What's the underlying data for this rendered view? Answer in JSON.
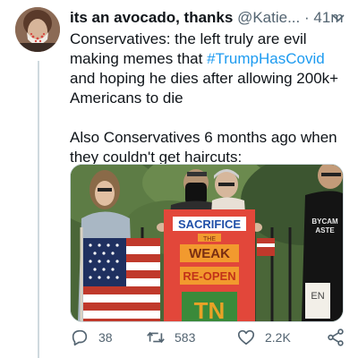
{
  "tweet": {
    "display_name": "its an avocado, thanks",
    "handle": "@Katie...",
    "separator": "·",
    "time": "41m",
    "text_line1_pre": "Conservatives: the left truly are evil making memes that ",
    "hashtag": "#TrumpHasCovid",
    "text_line1_post": " and hoping he dies after allowing 200k+ Americans to die",
    "text_para2": "Also Conservatives 6 months ago when they couldn't get haircuts:",
    "media": {
      "sign_line1": "SACRIFICE",
      "sign_line2": "THE",
      "sign_line3": "WEAK",
      "sign_line4": "RE-OPEN",
      "sign_line5": "TN",
      "shirt_text_1": "BYCAM",
      "shirt_text_2": "ASTE",
      "side_sign": "EN"
    }
  },
  "actions": {
    "reply_count": "38",
    "retweet_count": "583",
    "like_count": "2.2K"
  },
  "colors": {
    "accent": "#1d9bf0",
    "secondary_text": "#536471",
    "sign_red": "#e2473a",
    "sign_orange": "#f29a2e"
  },
  "icons": {
    "caret": "chevron-down-icon",
    "reply": "reply-icon",
    "retweet": "retweet-icon",
    "like": "heart-icon",
    "share": "share-icon"
  }
}
